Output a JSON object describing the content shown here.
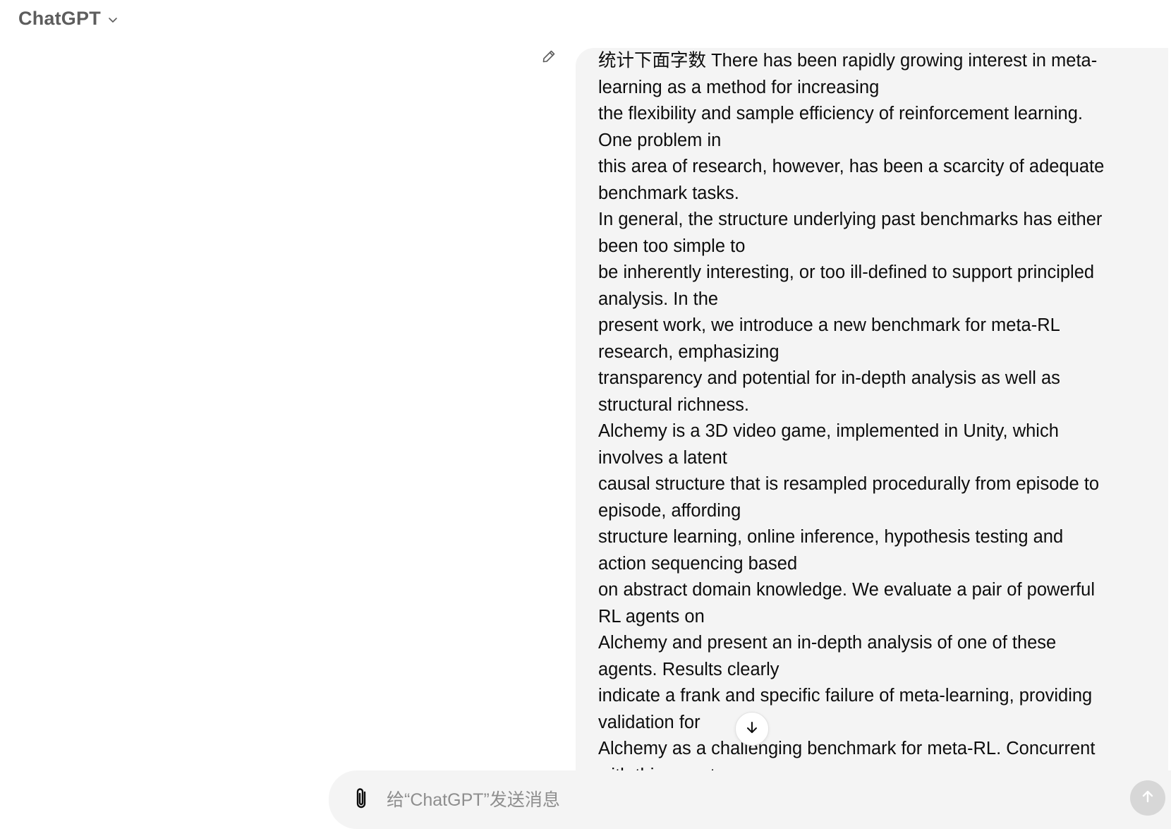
{
  "header": {
    "title": "ChatGPT",
    "dropdown_icon": "chevron-down-icon"
  },
  "message": {
    "edit_icon": "pencil-icon",
    "lines": [
      "统计下面字数   There has been rapidly growing interest in meta-",
      "learning as a method for increasing",
      "the flexibility and sample efficiency of reinforcement learning.",
      "One problem in",
      "this area of research, however, has been a scarcity of adequate",
      "benchmark tasks.",
      "In general, the structure underlying past benchmarks has either",
      "been too simple to",
      "be inherently interesting, or too ill-defined to support principled",
      "analysis. In the",
      "present work, we introduce a new benchmark for meta-RL",
      "research, emphasizing",
      "transparency and potential for in-depth analysis as well as",
      "structural richness.",
      "Alchemy is a 3D video game, implemented in Unity, which",
      "involves a latent",
      "causal structure that is resampled procedurally from episode to",
      "episode, affording",
      "structure learning, online inference, hypothesis testing and",
      "action sequencing based",
      "on abstract domain knowledge. We evaluate a pair of powerful",
      "RL agents on",
      "Alchemy and present an in-depth analysis of one of these",
      "agents. Results clearly",
      "indicate a frank and specific failure of meta-learning, providing",
      "validation for",
      "Alchemy as a challenging benchmark for meta-RL. Concurrent",
      "with this report,"
    ]
  },
  "scroll_button": {
    "icon": "arrow-down-icon"
  },
  "composer": {
    "attach_icon": "paperclip-icon",
    "placeholder": "给“ChatGPT”发送消息",
    "value": "",
    "send_icon": "arrow-up-icon"
  },
  "colors": {
    "bubble_bg": "#f4f4f4",
    "composer_bg": "#f4f4f4",
    "send_button_bg": "#d7d7d7",
    "header_text": "#5d5d5d",
    "placeholder_text": "#8e8e8e"
  }
}
